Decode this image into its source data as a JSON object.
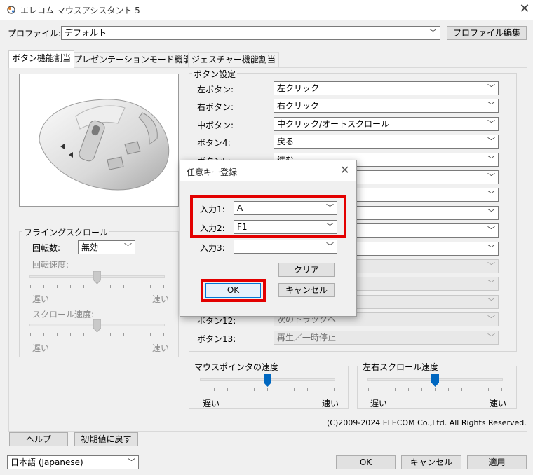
{
  "window": {
    "title": "エレコム マウスアシスタント 5",
    "close_glyph": "✕"
  },
  "profile": {
    "label": "プロファイル:",
    "value": "デフォルト",
    "edit_button": "プロファイル編集"
  },
  "tabs": [
    {
      "label": "ボタン機能割当",
      "active": true
    },
    {
      "label": "プレゼンテーションモード機能割当",
      "active": false
    },
    {
      "label": "ジェスチャー機能割当",
      "active": false
    }
  ],
  "button_settings": {
    "group_label": "ボタン設定",
    "rows": [
      {
        "label": "左ボタン:",
        "value": "左クリック",
        "enabled": true
      },
      {
        "label": "右ボタン:",
        "value": "右クリック",
        "enabled": true
      },
      {
        "label": "中ボタン:",
        "value": "中クリック/オートスクロール",
        "enabled": true
      },
      {
        "label": "ボタン4:",
        "value": "戻る",
        "enabled": true
      },
      {
        "label": "ボタン5:",
        "value": "進む",
        "enabled": true
      },
      {
        "label": "",
        "value": "",
        "enabled": true
      },
      {
        "label": "",
        "value": "",
        "enabled": true
      },
      {
        "label": "",
        "value": "",
        "enabled": true
      },
      {
        "label": "",
        "value": "",
        "enabled": true
      },
      {
        "label": "",
        "value": "",
        "enabled": true
      },
      {
        "label": "",
        "value": "",
        "enabled": false
      },
      {
        "label": "",
        "value": "",
        "enabled": false
      },
      {
        "label": "",
        "value": "",
        "enabled": false
      },
      {
        "label": "ボタン12:",
        "value": "次のトラックへ",
        "enabled": false
      },
      {
        "label": "ボタン13:",
        "value": "再生／一時停止",
        "enabled": false
      }
    ]
  },
  "flying_scroll": {
    "group_label": "フライングスクロール",
    "rotation_label": "回転数:",
    "rotation_value": "無効",
    "rotation_speed_label": "回転速度:",
    "rotation_speed_slow": "遅い",
    "rotation_speed_fast": "速い",
    "rotation_speed_level": 0.5,
    "scroll_speed_label": "スクロール速度:",
    "scroll_speed_slow": "遅い",
    "scroll_speed_fast": "速い",
    "scroll_speed_level": 0.5
  },
  "pointer_speed": {
    "group_label": "マウスポインタの速度",
    "slow": "遅い",
    "fast": "速い",
    "level": 0.5
  },
  "horizontal_scroll": {
    "group_label": "左右スクロール速度",
    "slow": "遅い",
    "fast": "速い",
    "level": 0.5
  },
  "copyright": "(C)2009-2024 ELECOM Co.,Ltd. All Rights Reserved.",
  "footer": {
    "help_button": "ヘルプ",
    "reset_button": "初期値に戻す",
    "language_value": "日本語 (Japanese)",
    "ok_button": "OK",
    "cancel_button": "キャンセル",
    "apply_button": "適用"
  },
  "dialog": {
    "title": "任意キー登録",
    "input1_label": "入力1:",
    "input1_value": "A",
    "input2_label": "入力2:",
    "input2_value": "F1",
    "input3_label": "入力3:",
    "input3_value": "",
    "clear_button": "クリア",
    "ok_button": "OK",
    "cancel_button": "キャンセル",
    "close_glyph": "✕"
  },
  "colors": {
    "highlight_red": "#e30000",
    "slider_thumb": "#0067c0"
  }
}
